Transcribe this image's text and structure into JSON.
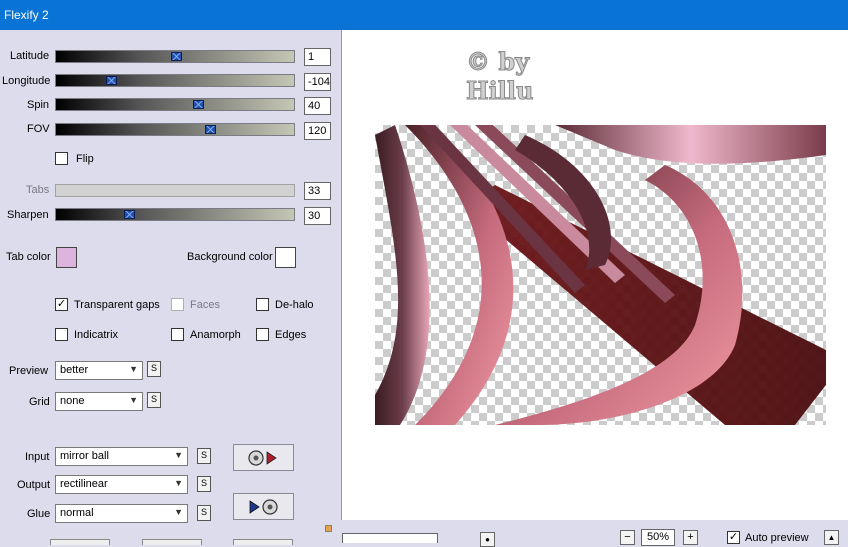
{
  "window": {
    "title": "Flexify 2"
  },
  "sliders": [
    {
      "label": "Latitude",
      "value": "1",
      "position": 0.51,
      "enabled": true
    },
    {
      "label": "Longitude",
      "value": "-104",
      "position": 0.22,
      "enabled": true
    },
    {
      "label": "Spin",
      "value": "40",
      "position": 0.61,
      "enabled": true
    },
    {
      "label": "FOV",
      "value": "120",
      "position": 0.66,
      "enabled": true
    },
    {
      "label": "Tabs",
      "value": "33",
      "enabled": false
    },
    {
      "label": "Sharpen",
      "value": "30",
      "position": 0.3,
      "enabled": true
    }
  ],
  "flip": {
    "label": "Flip",
    "checked": false
  },
  "colors": {
    "tab_color_label": "Tab color",
    "tab_color": "#dcb4de",
    "background_color_label": "Background color",
    "background_color": "#ffffff",
    "title_bar": "#0a74d6",
    "panel": "#dcdcec",
    "slider_thumb": "#1f4fa6"
  },
  "checkboxes": {
    "transparent_gaps": {
      "label": "Transparent gaps",
      "checked": true
    },
    "faces": {
      "label": "Faces",
      "checked": false,
      "enabled": false
    },
    "de_halo": {
      "label": "De-halo",
      "checked": false
    },
    "indicatrix": {
      "label": "Indicatrix",
      "checked": false
    },
    "anamorph": {
      "label": "Anamorph",
      "checked": false
    },
    "edges": {
      "label": "Edges",
      "checked": false
    }
  },
  "dropdowns": {
    "preview": {
      "label": "Preview",
      "value": "better"
    },
    "grid": {
      "label": "Grid",
      "value": "none"
    },
    "input": {
      "label": "Input",
      "value": "mirror ball"
    },
    "output": {
      "label": "Output",
      "value": "rectilinear"
    },
    "glue": {
      "label": "Glue",
      "value": "normal"
    }
  },
  "small_button_label": "S",
  "bottom_bar": {
    "zoom": "50%",
    "zoom_out": "−",
    "zoom_in": "+",
    "auto_preview_label": "Auto preview",
    "auto_preview_checked": true
  },
  "watermark": {
    "line1": "© by",
    "line2": "Hillu"
  },
  "icons": {
    "input_projection": "disc-to-play-icon",
    "output_projection": "play-to-disc-icon"
  }
}
